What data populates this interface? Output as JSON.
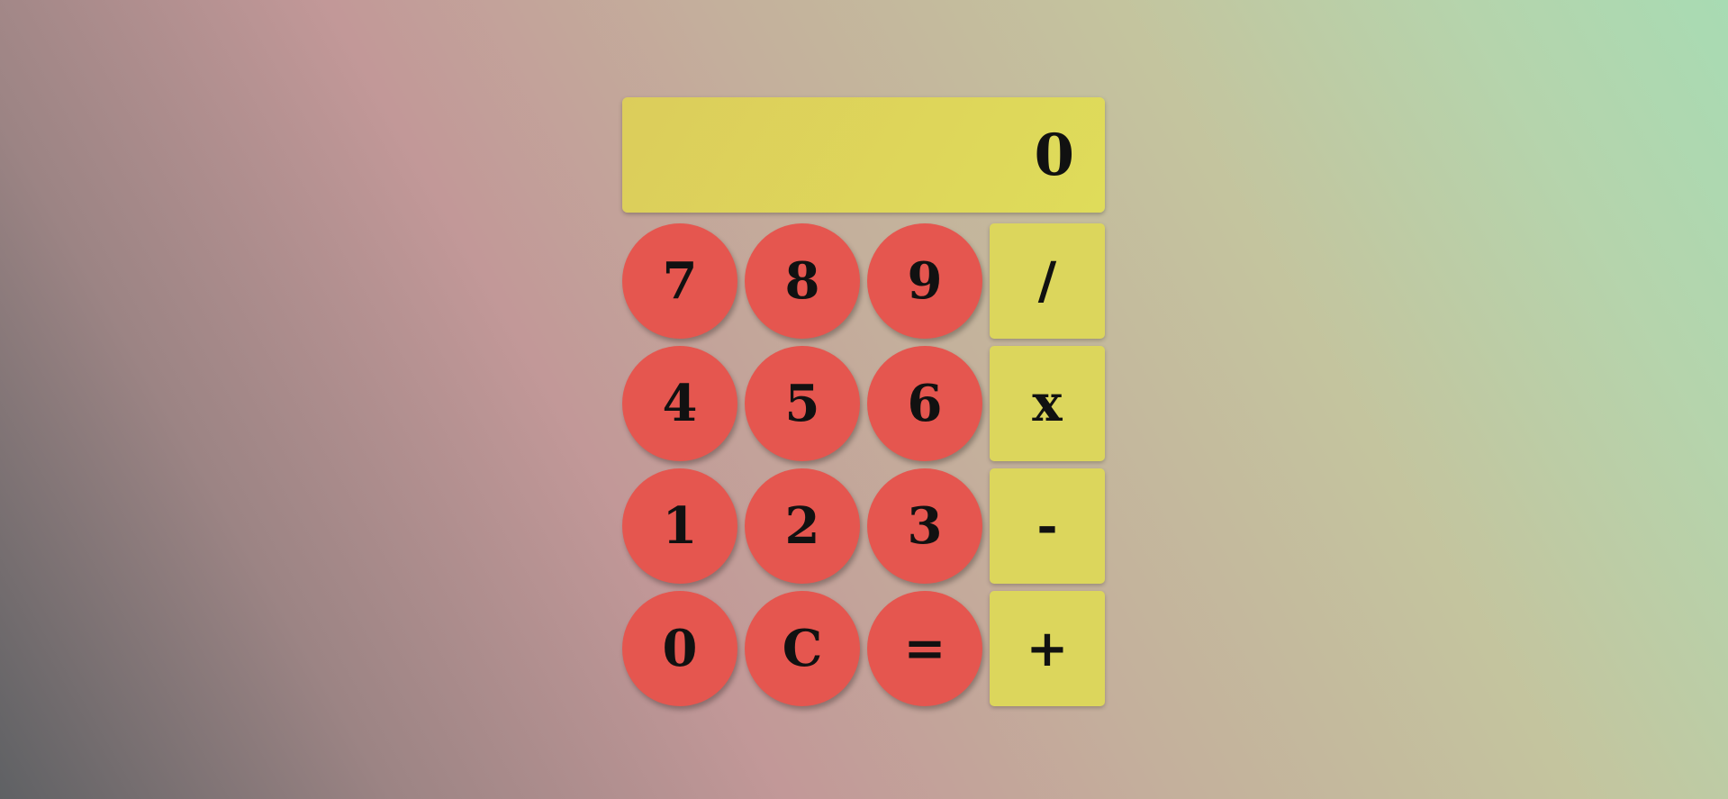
{
  "display": {
    "value": "0"
  },
  "keys": {
    "row1": [
      "7",
      "8",
      "9",
      "/"
    ],
    "row2": [
      "4",
      "5",
      "6",
      "x"
    ],
    "row3": [
      "1",
      "2",
      "3",
      "-"
    ],
    "row4": [
      "0",
      "C",
      "=",
      "+"
    ]
  },
  "colors": {
    "number_key": "#e5564f",
    "operator_key": "#dcd65c",
    "display_bg": "#dfd85a",
    "text": "#111111"
  }
}
